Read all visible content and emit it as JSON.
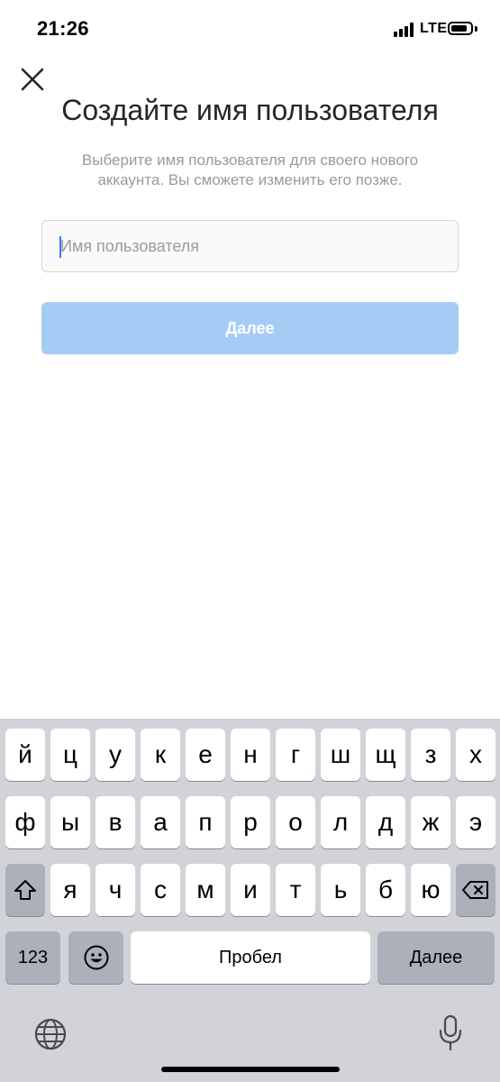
{
  "status_bar": {
    "time": "21:26",
    "network": "LTE"
  },
  "screen": {
    "title": "Создайте имя пользователя",
    "subtitle": "Выберите имя пользователя для своего нового аккаунта. Вы сможете изменить его позже.",
    "username_input": {
      "value": "",
      "placeholder": "Имя пользователя"
    },
    "next_button": "Далее"
  },
  "keyboard": {
    "row1": [
      "й",
      "ц",
      "у",
      "к",
      "е",
      "н",
      "г",
      "ш",
      "щ",
      "з",
      "х"
    ],
    "row2": [
      "ф",
      "ы",
      "в",
      "а",
      "п",
      "р",
      "о",
      "л",
      "д",
      "ж",
      "э"
    ],
    "row3": [
      "я",
      "ч",
      "с",
      "м",
      "и",
      "т",
      "ь",
      "б",
      "ю"
    ],
    "numbers_key": "123",
    "space_key": "Пробел",
    "return_key": "Далее",
    "icons": [
      "shift-icon",
      "backspace-icon",
      "emoji-icon",
      "globe-icon",
      "microphone-icon"
    ]
  },
  "colors": {
    "primary_button_disabled": "#a6ccf6",
    "caret": "#3478f6",
    "keyboard_bg": "#d1d3d9"
  }
}
